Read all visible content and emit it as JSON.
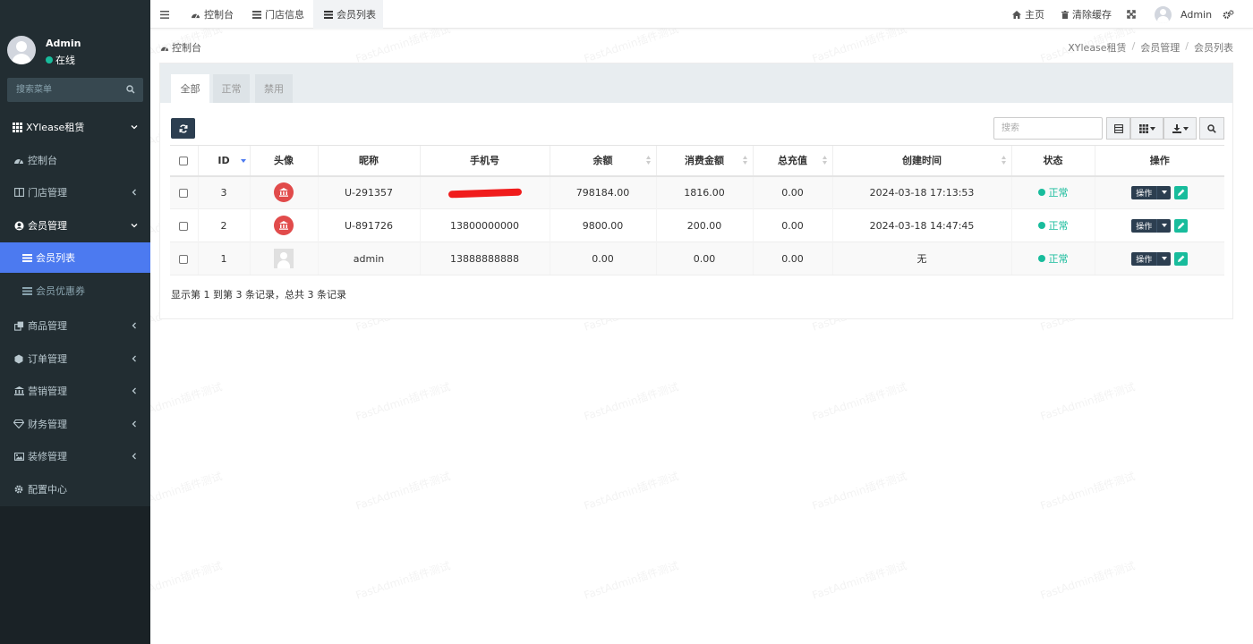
{
  "user": {
    "name": "Admin",
    "status": "在线"
  },
  "sidebar": {
    "search_placeholder": "搜索菜单",
    "items": [
      {
        "label": "XYlease租赁",
        "icon": "grid-icon"
      },
      {
        "label": "控制台",
        "icon": "dashboard-icon"
      },
      {
        "label": "门店管理",
        "icon": "columns-icon"
      },
      {
        "label": "会员管理",
        "icon": "user-circle-icon"
      },
      {
        "label": "会员列表",
        "icon": "list-icon"
      },
      {
        "label": "会员优惠券",
        "icon": "list-icon"
      },
      {
        "label": "商品管理",
        "icon": "clone-icon"
      },
      {
        "label": "订单管理",
        "icon": "cube-icon"
      },
      {
        "label": "营销管理",
        "icon": "bank-icon"
      },
      {
        "label": "财务管理",
        "icon": "diamond-icon"
      },
      {
        "label": "装修管理",
        "icon": "photo-icon"
      },
      {
        "label": "配置中心",
        "icon": "gear-icon"
      }
    ]
  },
  "topbar": {
    "tabs": [
      {
        "label": "控制台"
      },
      {
        "label": "门店信息"
      },
      {
        "label": "会员列表"
      }
    ],
    "home": "主页",
    "clear_cache": "清除缓存",
    "admin": "Admin"
  },
  "breadcrumb": {
    "left": "控制台",
    "items": [
      "XYlease租赁",
      "会员管理",
      "会员列表"
    ]
  },
  "panel": {
    "tabs": [
      "全部",
      "正常",
      "禁用"
    ],
    "search_placeholder": "搜索"
  },
  "table": {
    "headers": [
      "ID",
      "头像",
      "昵称",
      "手机号",
      "余额",
      "消费金额",
      "总充值",
      "创建时间",
      "状态",
      "操作"
    ],
    "rows": [
      {
        "id": "3",
        "nickname": "U-291357",
        "phone": "",
        "balance": "798184.00",
        "spent": "1816.00",
        "recharge": "0.00",
        "created": "2024-03-18 17:13:53",
        "status": "正常",
        "op": "操作",
        "avatar": "logo"
      },
      {
        "id": "2",
        "nickname": "U-891726",
        "phone": "13800000000",
        "balance": "9800.00",
        "spent": "200.00",
        "recharge": "0.00",
        "created": "2024-03-18 14:47:45",
        "status": "正常",
        "op": "操作",
        "avatar": "logo"
      },
      {
        "id": "1",
        "nickname": "admin",
        "phone": "13888888888",
        "balance": "0.00",
        "spent": "0.00",
        "recharge": "0.00",
        "created": "无",
        "status": "正常",
        "op": "操作",
        "avatar": "default"
      }
    ],
    "summary": "显示第 1 到第 3 条记录，总共 3 条记录"
  },
  "watermark": "FastAdmin插件测试",
  "colors": {
    "sidebar": "#222d32",
    "active": "#4c7af0",
    "success": "#18bc9c",
    "primary": "#2c3e50"
  }
}
